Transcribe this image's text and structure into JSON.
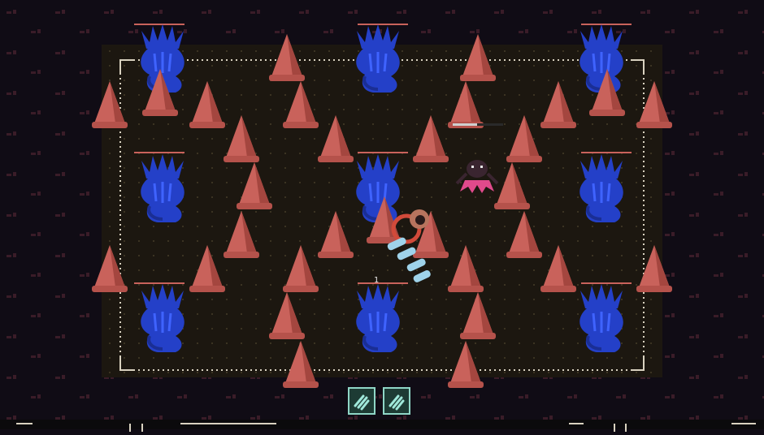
{
  "colors": {
    "background": "#100c15",
    "arena_floor": "#1c1710",
    "arena_border": "#d9d2c0",
    "spike": "#c9625b",
    "spike_shade": "#a4463f",
    "statue": "#2440c8",
    "statue_light": "#3f63ff",
    "enemy_dark": "#3a2530",
    "enemy_pink": "#e04a8c",
    "projectile": "#9fd3ea",
    "player": "#d14a3a",
    "hud_slot": "#1d3b34",
    "hud_slot_border": "#8fd6c6"
  },
  "icons": {
    "spike": "cone-spike-icon",
    "statue": "blue-serpent-statue-icon",
    "enemy": "spider-enemy-icon",
    "player": "player-character-icon",
    "projectile": "ice-shard-icon",
    "ability": "dash-ability-icon"
  },
  "hud": {
    "slots": [
      {
        "name": "ability-slot-1",
        "icon": "dash-ability-icon"
      },
      {
        "name": "ability-slot-2",
        "icon": "dash-ability-icon"
      }
    ]
  },
  "floating_text": {
    "damage": "1"
  }
}
